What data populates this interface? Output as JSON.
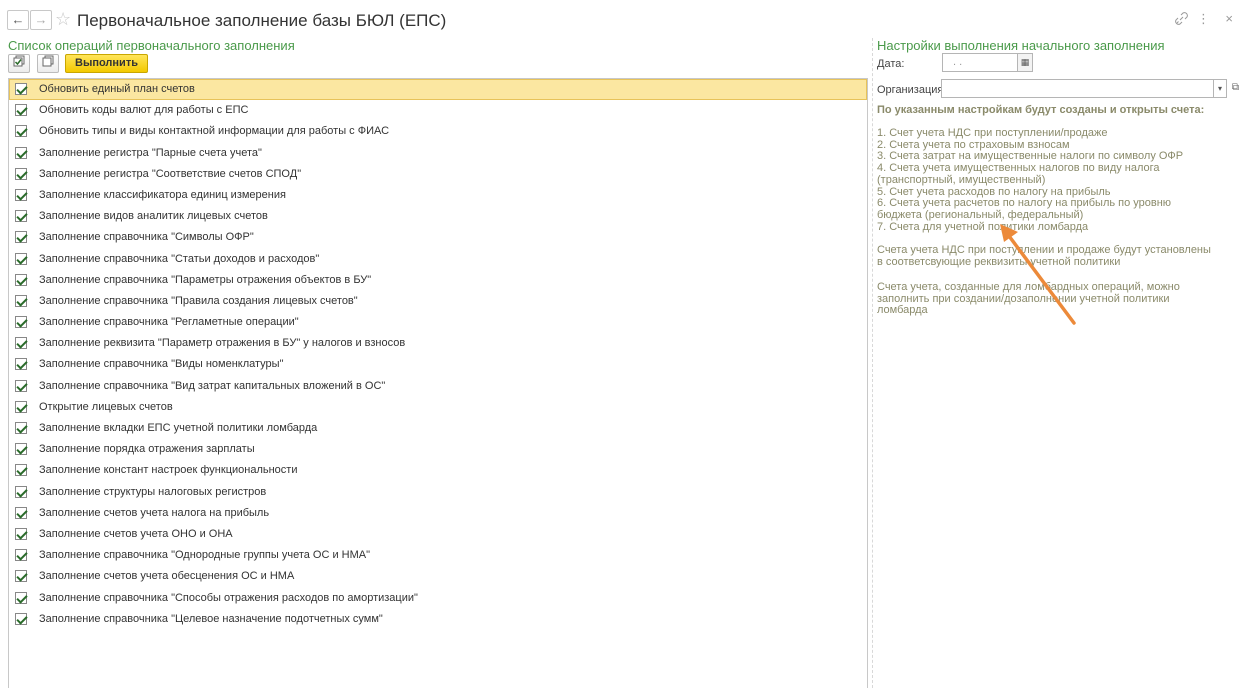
{
  "window": {
    "title": "Первоначальное заполнение базы БЮЛ (ЕПС)",
    "back_icon": "←",
    "forward_icon": "→",
    "star_icon": "☆",
    "link_icon": "🔗",
    "menu_icon": "⋮",
    "close_icon": "×"
  },
  "left": {
    "heading": "Список операций первоначального заполнения",
    "toolbar": {
      "check_all_icon": "☑",
      "uncheck_all_icon": "☐",
      "run_label": "Выполнить"
    },
    "operations": [
      {
        "label": "Обновить единый план счетов",
        "checked": true,
        "selected": true
      },
      {
        "label": "Обновить коды валют для работы с ЕПС",
        "checked": true
      },
      {
        "label": "Обновить типы и виды контактной информации для работы с ФИАС",
        "checked": true
      },
      {
        "label": "Заполнение регистра \"Парные счета учета\"",
        "checked": true
      },
      {
        "label": "Заполнение регистра \"Соответствие счетов СПОД\"",
        "checked": true
      },
      {
        "label": "Заполнение классификатора единиц измерения",
        "checked": true
      },
      {
        "label": "Заполнение видов аналитик лицевых счетов",
        "checked": true
      },
      {
        "label": "Заполнение справочника \"Символы ОФР\"",
        "checked": true
      },
      {
        "label": "Заполнение справочника \"Статьи доходов и расходов\"",
        "checked": true
      },
      {
        "label": "Заполнение справочника \"Параметры отражения объектов в БУ\"",
        "checked": true
      },
      {
        "label": "Заполнение справочника \"Правила создания лицевых счетов\"",
        "checked": true
      },
      {
        "label": "Заполнение справочника \"Регламетные операции\"",
        "checked": true
      },
      {
        "label": "Заполнение реквизита \"Параметр отражения в БУ\" у налогов и взносов",
        "checked": true
      },
      {
        "label": "Заполнение справочника \"Виды номенклатуры\"",
        "checked": true
      },
      {
        "label": "Заполнение справочника \"Вид затрат капитальных вложений в ОС\"",
        "checked": true
      },
      {
        "label": "Открытие лицевых счетов",
        "checked": true
      },
      {
        "label": "Заполнение вкладки ЕПС учетной политики ломбарда",
        "checked": true
      },
      {
        "label": "Заполнение порядка отражения зарплаты",
        "checked": true
      },
      {
        "label": "Заполнение констант настроек функциональности",
        "checked": true
      },
      {
        "label": "Заполнение структуры налоговых регистров",
        "checked": true
      },
      {
        "label": "Заполнение счетов учета налога на прибыль",
        "checked": true
      },
      {
        "label": "Заполнение счетов учета ОНО и ОНА",
        "checked": true
      },
      {
        "label": "Заполнение справочника \"Однородные группы учета ОС и НМА\"",
        "checked": true
      },
      {
        "label": "Заполнение счетов учета обесценения ОС и НМА",
        "checked": true
      },
      {
        "label": "Заполнение справочника \"Способы отражения расходов по амортизации\"",
        "checked": true
      },
      {
        "label": "Заполнение справочника \"Целевое назначение подотчетных сумм\"",
        "checked": true
      }
    ]
  },
  "right": {
    "heading": "Настройки выполнения начального заполнения",
    "date_label": "Дата:",
    "date_value": " .  . ",
    "calendar_icon": "▦",
    "org_label": "Организация:",
    "org_value": "",
    "dropdown_icon": "▾",
    "open_icon": "⧉",
    "info_title": "По указанным настройкам будут созданы и открыты счета:",
    "info_list": [
      "1. Счет учета НДС при поступлении/продаже",
      "2. Счета учета по страховым взносам",
      "3. Счета затрат на имущественные налоги по символу ОФР",
      "4. Счета учета имущественных налогов по виду налога",
      "(транспортный, имущественный)",
      "5. Счет учета расходов по налогу на прибыль",
      "6. Счета учета расчетов по налогу на прибыль по уровню",
      "бюджета (региональный, федеральный)",
      "7. Счета для учетной политики ломбарда"
    ],
    "note1": [
      "Счета учета НДС при поступлении и продаже будут установлены",
      "в соответсвующие реквизиты учетной политики"
    ],
    "note2": [
      "Счета учета, созданные для ломбардных операций, можно",
      "заполнить при создании/дозаполнении учетной политики",
      "ломбарда"
    ],
    "accent_color": "#4a9a4a",
    "arrow_color": "#ec8a3a"
  }
}
